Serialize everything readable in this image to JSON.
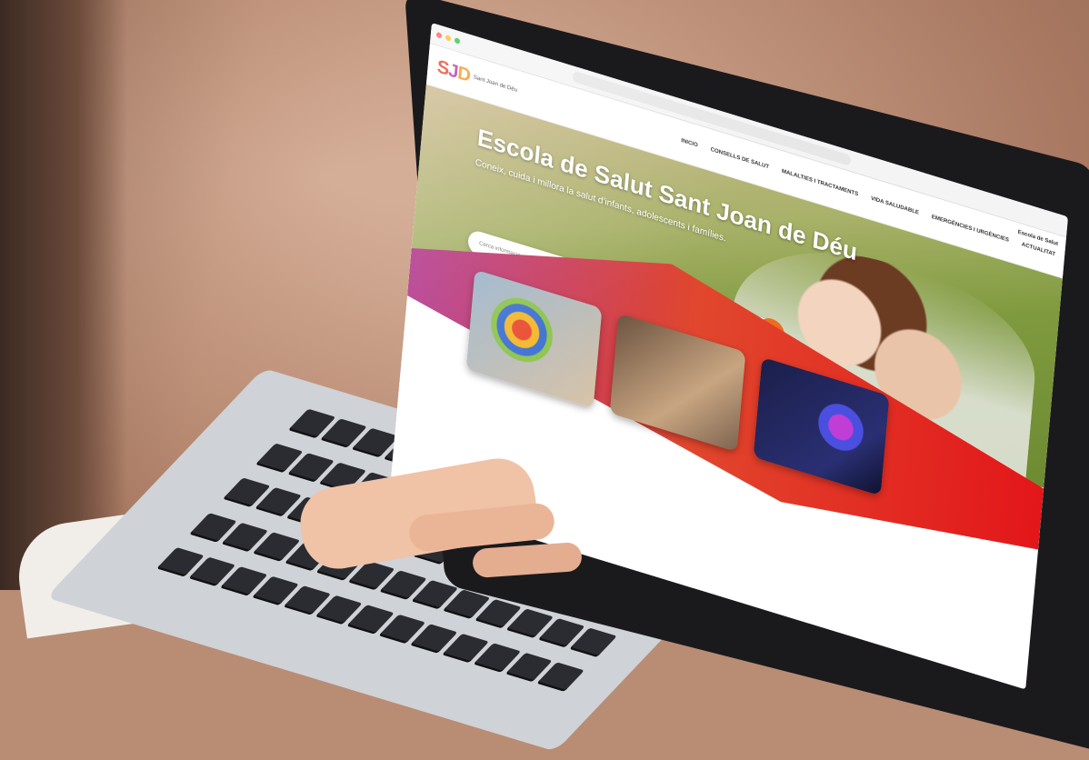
{
  "photo": {
    "subject": "laptop-on-desk",
    "accent": "#e3161a"
  },
  "browser": {
    "url_text": ""
  },
  "site": {
    "logo_mark": "SJD",
    "logo_text": "Sant Joan de Déu",
    "nav": [
      "INICIO",
      "CONSELLS DE SALUT",
      "MALALTIES I TRACTAMENTS",
      "VIDA SALUDABLE",
      "EMERGÈNCIES I URGÈNCIES",
      "ACTUALITAT"
    ],
    "utility": "Escola de Salut",
    "hero_title": "Escola de Salut Sant Joan de Déu",
    "hero_subtitle": "Coneix, cuida i millora la salut d'infants, adolescents i famílies.",
    "search_placeholder": "Cerca informació sobre salut",
    "search_icon": "magnifier-icon",
    "cards": [
      {
        "caption": ""
      },
      {
        "caption": ""
      },
      {
        "caption": ""
      }
    ]
  }
}
